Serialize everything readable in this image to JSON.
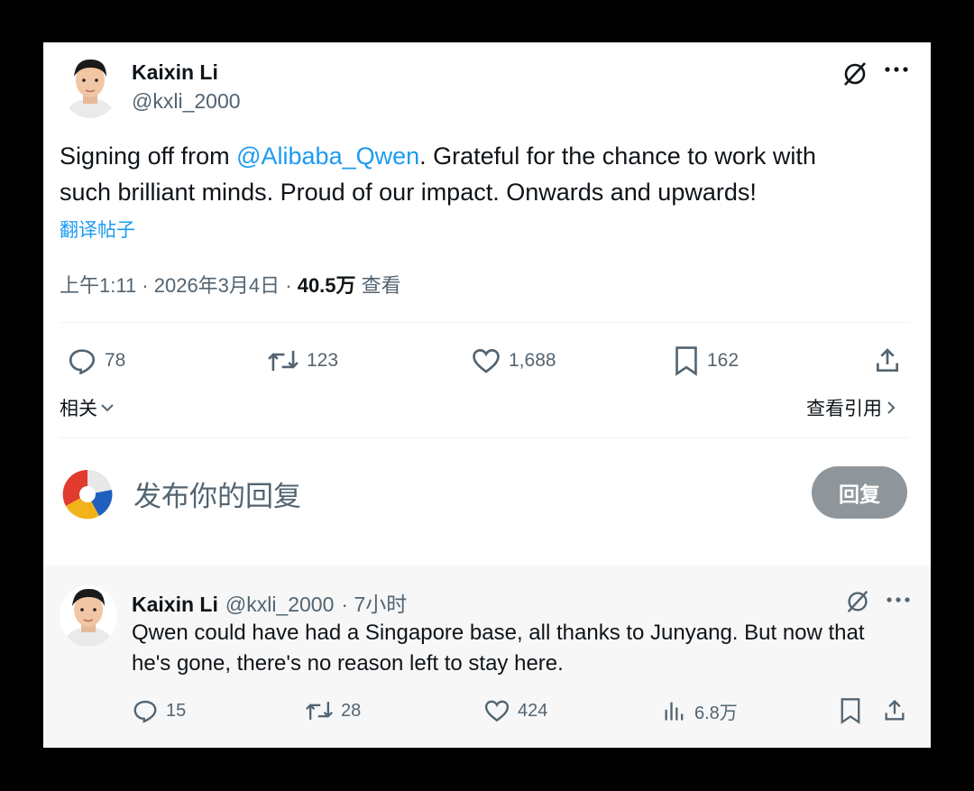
{
  "tweet": {
    "author_name": "Kaixin Li",
    "author_handle": "@kxli_2000",
    "text_prefix": "Signing off from ",
    "mention": "@Alibaba_Qwen",
    "text_line1_rest": ". Grateful for the chance to work with",
    "text_line2": "such brilliant minds. Proud of our impact. Onwards and upwards!",
    "translate_label": "翻译帖子",
    "timestamp": "上午1:11 · 2026年3月4日 · ",
    "views_count": "40.5万",
    "views_label": " 查看",
    "stats": {
      "replies": "78",
      "reposts": "123",
      "likes": "1,688",
      "bookmarks": "162"
    },
    "related_label": "相关",
    "view_quotes_label": "查看引用"
  },
  "composer": {
    "placeholder": "发布你的回复",
    "reply_button": "回复"
  },
  "reply": {
    "author_name": "Kaixin Li",
    "author_handle": "@kxli_2000",
    "time": "· 7小时",
    "text_line1": "Qwen could have had a Singapore base, all thanks to Junyang. But now that",
    "text_line2": "he's gone, there's no reason left to stay here.",
    "stats": {
      "replies": "15",
      "reposts": "28",
      "likes": "424",
      "views": "6.8万"
    }
  },
  "colors": {
    "link": "#1d9bf0",
    "secondary_text": "#536471",
    "reply_button_bg": "#8f969b"
  },
  "icons": [
    "grok-icon",
    "more-icon",
    "reply-icon",
    "repost-icon",
    "like-icon",
    "bookmark-icon",
    "share-icon",
    "analytics-icon",
    "chevron-down-icon",
    "chevron-right-icon"
  ]
}
